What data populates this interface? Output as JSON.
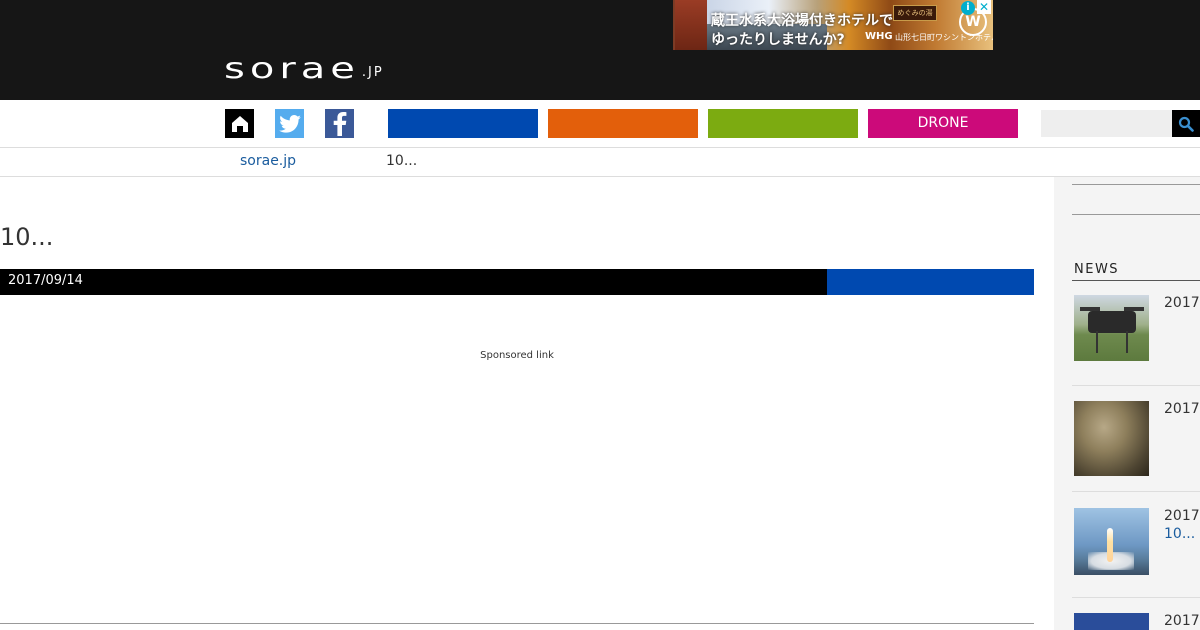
{
  "header": {
    "logo_main": "sorae",
    "logo_tld": ".JP"
  },
  "ad": {
    "line1": "蔵王水系大浴場付きホテルで",
    "line2": "ゆったりしませんか?",
    "brand": "WHG",
    "hotel_name": "山形七日町ワシントンホテル",
    "sign": "めぐみの湯",
    "info_icon": "i",
    "close_icon": "✕"
  },
  "nav": {
    "categories": [
      "",
      "",
      "",
      "DRONE"
    ],
    "colors": [
      "#0049b0",
      "#e35f0b",
      "#7cab11",
      "#cc0a7a"
    ],
    "search_value": "",
    "icons": [
      "home-icon",
      "twitter-icon",
      "facebook-icon",
      "search-icon"
    ]
  },
  "breadcrumb": {
    "home": "sorae.jp",
    "current": "10..."
  },
  "article": {
    "title": "10...",
    "date": "2017/09/14",
    "sponsored": "Sponsored link"
  },
  "sidebar": {
    "news_heading": "NEWS",
    "items": [
      {
        "date": "2017",
        "link": ""
      },
      {
        "date": "2017",
        "link": ""
      },
      {
        "date": "2017",
        "link": "10..."
      },
      {
        "date": "2017",
        "link": ""
      }
    ]
  }
}
